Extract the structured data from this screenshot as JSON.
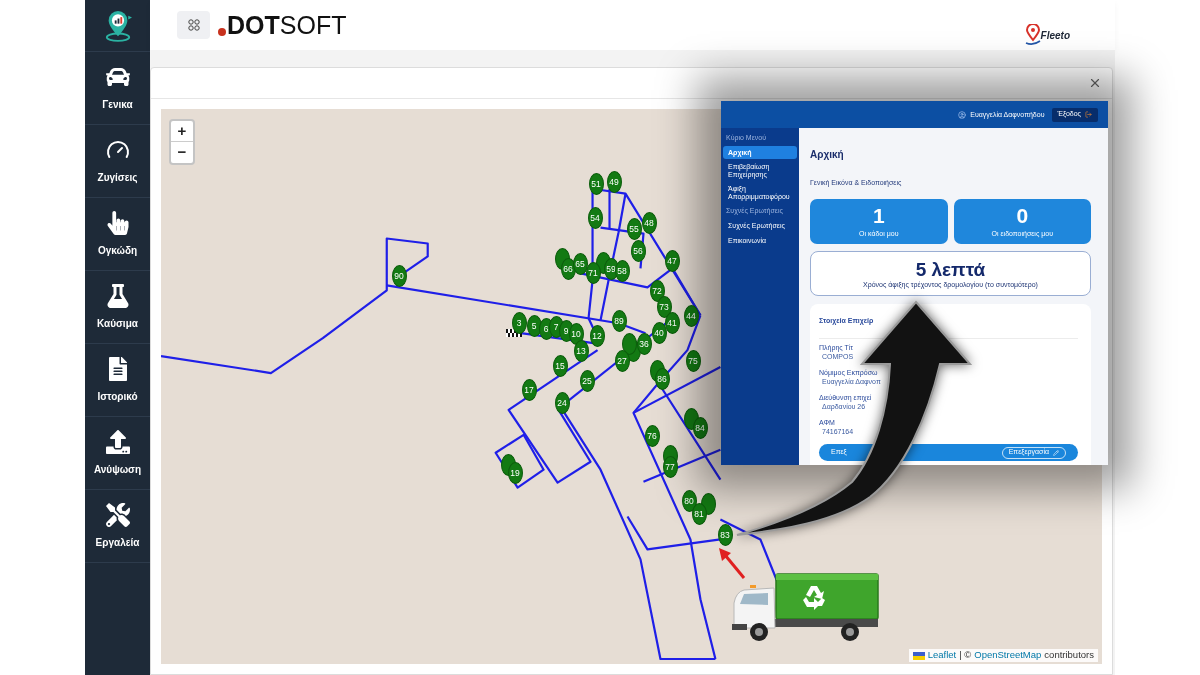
{
  "sidebar": {
    "items": [
      {
        "label": "Γενικα"
      },
      {
        "label": "Ζυγίσεις"
      },
      {
        "label": "Ογκώδη"
      },
      {
        "label": "Καύσιμα"
      },
      {
        "label": "Ιστορικό"
      },
      {
        "label": "Ανύψωση"
      },
      {
        "label": "Εργαλεία"
      }
    ]
  },
  "header": {
    "logo": "**DOT**SOFT",
    "brand": "Fleeto"
  },
  "map": {
    "zoom_controls": [
      "+",
      "−"
    ],
    "markers": [
      {
        "label": "51"
      },
      {
        "label": "49"
      },
      {
        "label": "54"
      },
      {
        "label": "55"
      },
      {
        "label": "48"
      },
      {
        "label": "56"
      },
      {
        "label": "90"
      },
      {
        "label": "66"
      },
      {
        "label": "65"
      },
      {
        "label": "71"
      },
      {
        "label": "59"
      },
      {
        "label": "58"
      },
      {
        "label": "47"
      },
      {
        "label": "72"
      },
      {
        "label": "73"
      },
      {
        "label": "3"
      },
      {
        "label": "5"
      },
      {
        "label": "6"
      },
      {
        "label": "7"
      },
      {
        "label": "9"
      },
      {
        "label": "10"
      },
      {
        "label": "12"
      },
      {
        "label": "89"
      },
      {
        "label": "40"
      },
      {
        "label": "41"
      },
      {
        "label": "44"
      },
      {
        "label": "15"
      },
      {
        "label": "13"
      },
      {
        "label": "27"
      },
      {
        "label": "36"
      },
      {
        "label": "75"
      },
      {
        "label": "17"
      },
      {
        "label": "25"
      },
      {
        "label": "86"
      },
      {
        "label": "24"
      },
      {
        "label": "76"
      },
      {
        "label": "84"
      },
      {
        "label": "19"
      },
      {
        "label": "77"
      },
      {
        "label": "80"
      },
      {
        "label": "81"
      },
      {
        "label": "83"
      }
    ],
    "attribution": [
      {
        "kind": "link",
        "text": "Leaflet"
      },
      {
        "kind": "text",
        "text": "| ©"
      },
      {
        "kind": "link",
        "text": "OpenStreetMap"
      },
      {
        "kind": "text",
        "text": "contributors"
      }
    ]
  },
  "inset_app": {
    "user": "Ευαγγελία Δαφνοπήδου",
    "logout": "Έξοδος",
    "menu": [
      {
        "kind": "heading",
        "label": "Κύριο Μενού"
      },
      {
        "kind": "item",
        "label": "Αρχική",
        "selected": true
      },
      {
        "kind": "item",
        "label": "Επιβεβαίωση Επιχείρησης",
        "selected": false
      },
      {
        "kind": "item",
        "label": "Άφιξη Απορριμματοφόρου",
        "selected": false
      },
      {
        "kind": "heading",
        "label": "Συχνές Ερωτήσεις"
      },
      {
        "kind": "item",
        "label": "Συχνές Ερωτήσεις",
        "selected": false
      },
      {
        "kind": "item",
        "label": "Επικοινωνία",
        "selected": false
      }
    ],
    "title": "Αρχική",
    "subtitle": "Γενική Εικόνα & Ειδοποιήσεις",
    "stats": [
      {
        "value": "1",
        "label": "Οι κάδοι μου"
      },
      {
        "value": "0",
        "label": "Οι ειδοποιήσεις μου"
      }
    ],
    "arrival": {
      "value": "5 λεπτά",
      "label": "Χρόνος άφιξης τρέχοντος δρομολογίου (το συντομότερο)"
    },
    "details": {
      "title": "Στοιχεία Επιχείρ",
      "fields": [
        {
          "label": "Πλήρης Τίτ",
          "value": "COMPOS"
        },
        {
          "label": "Νόμιμος Εκπρόσω",
          "value": "Ευαγγελία Δαφνοπ"
        },
        {
          "label": "Διεύθυνση επιχεί",
          "value": "Δαρδανίου 26"
        },
        {
          "label": "ΑΦΜ",
          "value": "74167164"
        }
      ]
    },
    "edit_bar": {
      "text": "Επεξ",
      "button": "Επεξεργασία"
    }
  }
}
